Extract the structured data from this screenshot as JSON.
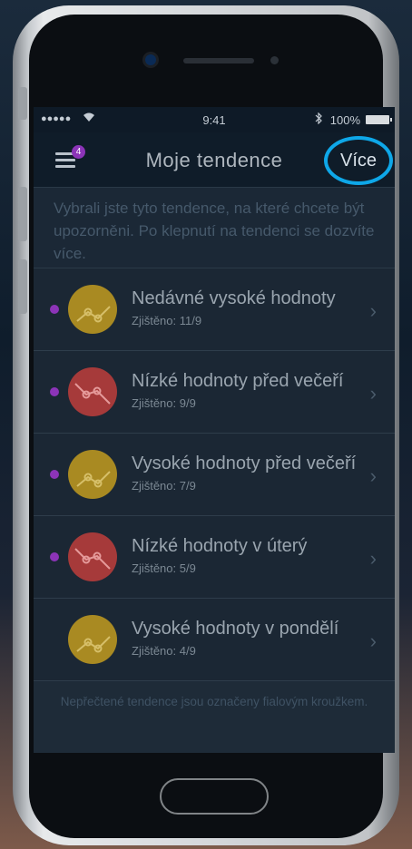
{
  "status_bar": {
    "signal": "●●●●●",
    "wifi_icon": "wifi-icon",
    "time": "9:41",
    "bluetooth_icon": "bluetooth-icon",
    "battery": "100%"
  },
  "nav": {
    "title": "Moje tendence",
    "menu_badge": "4",
    "more_label": "Více"
  },
  "intro_text": "Vybrali jste tyto tendence, na které chcete být upozorněni. Po klepnutí na tendenci se dozvíte více.",
  "trends": [
    {
      "title": "Nedávné vysoké hodnoty",
      "detected": "Zjištěno: 11/9",
      "kind": "high",
      "unread": true
    },
    {
      "title": "Nízké hodnoty před večeří",
      "detected": "Zjištěno: 9/9",
      "kind": "low",
      "unread": true
    },
    {
      "title": "Vysoké hodnoty před večeří",
      "detected": "Zjištěno: 7/9",
      "kind": "high",
      "unread": true
    },
    {
      "title": "Nízké hodnoty v úterý",
      "detected": "Zjištěno: 5/9",
      "kind": "low",
      "unread": true
    },
    {
      "title": "Vysoké hodnoty v pondělí",
      "detected": "Zjištěno: 4/9",
      "kind": "high",
      "unread": false
    }
  ],
  "footer_note": "Nepřečtené tendence jsou označeny fialovým kroužkem.",
  "colors": {
    "high": "#a98a22",
    "low": "#a63a3a",
    "unread_dot": "#8c34b8",
    "accent_ring": "#0ea7e8"
  },
  "icons": {
    "chevron": "›"
  }
}
